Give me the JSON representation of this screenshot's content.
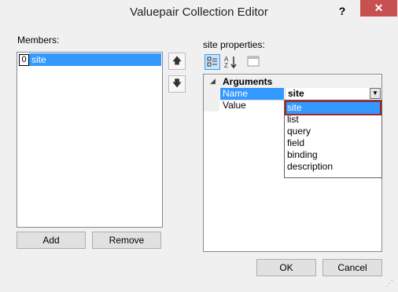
{
  "window": {
    "title": "Valuepair Collection Editor",
    "help": "?",
    "close": "✕"
  },
  "members": {
    "label": "Members:",
    "items": [
      {
        "index": "0",
        "name": "site"
      }
    ]
  },
  "arrows": {
    "up": "🡅",
    "down": "🡇"
  },
  "buttons": {
    "add": "Add",
    "remove": "Remove",
    "ok": "OK",
    "cancel": "Cancel"
  },
  "properties": {
    "label": "site properties:",
    "category": "Arguments",
    "rows": [
      {
        "name": "Name",
        "value": "site"
      },
      {
        "name": "Value",
        "value": ""
      }
    ]
  },
  "dropdown": {
    "selected": "site",
    "options": [
      "site",
      "list",
      "query",
      "field",
      "binding",
      "description"
    ]
  },
  "icons": [
    "categorized-icon",
    "alphabetical-icon",
    "property-pages-icon",
    "chevron-down-icon"
  ]
}
